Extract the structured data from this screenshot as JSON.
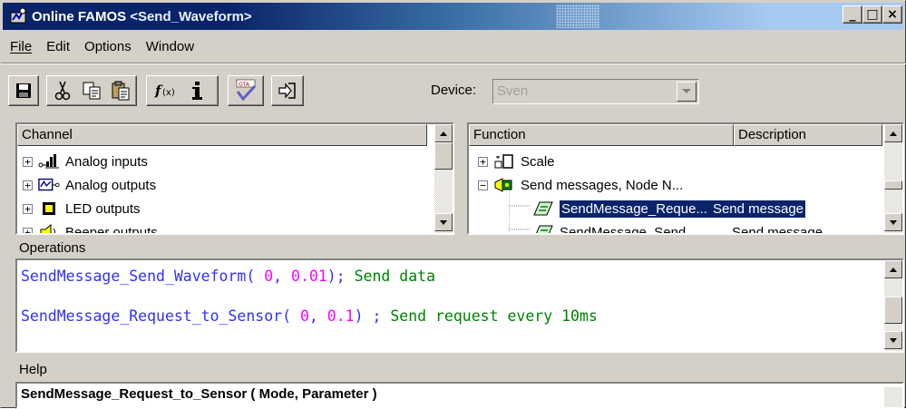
{
  "window": {
    "app_title": "Online FAMOS",
    "doc_title": "<Send_Waveform>",
    "buttons": {
      "minimize": "_",
      "maximize": "□",
      "close": "×"
    }
  },
  "menu": [
    {
      "label": "File"
    },
    {
      "label": "Edit"
    },
    {
      "label": "Options"
    },
    {
      "label": "Window"
    }
  ],
  "toolbar": {
    "icons": [
      "save-icon",
      "cut-icon",
      "copy-icon",
      "paste-icon",
      "function-icon",
      "info-icon",
      "check-icon",
      "exit-icon"
    ],
    "device_label": "Device:",
    "device_value": "Sven"
  },
  "channel_panel": {
    "header": "Channel",
    "items": [
      {
        "label": "Analog inputs",
        "expander": "+"
      },
      {
        "label": "Analog outputs",
        "expander": "+"
      },
      {
        "label": "LED outputs",
        "expander": "+"
      },
      {
        "label": "Beeper outputs",
        "expander": "+"
      }
    ]
  },
  "function_panel": {
    "headers": [
      "Function",
      "Description"
    ],
    "items": [
      {
        "label": "Scale",
        "expander": "+",
        "description": ""
      },
      {
        "label": "Send messages, Node N...",
        "expander": "−",
        "description": ""
      },
      {
        "label": "SendMessage_Reque...",
        "description": "Send message",
        "selected": true
      },
      {
        "label": "SendMessage_Send...",
        "description": "Send message"
      }
    ]
  },
  "operations": {
    "label": "Operations",
    "lines": [
      {
        "fn": "SendMessage_Send_Waveform( ",
        "a": "0",
        "sep": ", ",
        "b": "0.01",
        "end": "); ",
        "comment": "Send data"
      },
      {
        "fn": "SendMessage_Request_to_Sensor( ",
        "a": "0",
        "sep": ", ",
        "b": "0.1",
        "end": ") ; ",
        "comment": "Send request every 10ms"
      }
    ]
  },
  "help": {
    "label": "Help",
    "text": "SendMessage_Request_to_Sensor ( Mode, Parameter )"
  }
}
